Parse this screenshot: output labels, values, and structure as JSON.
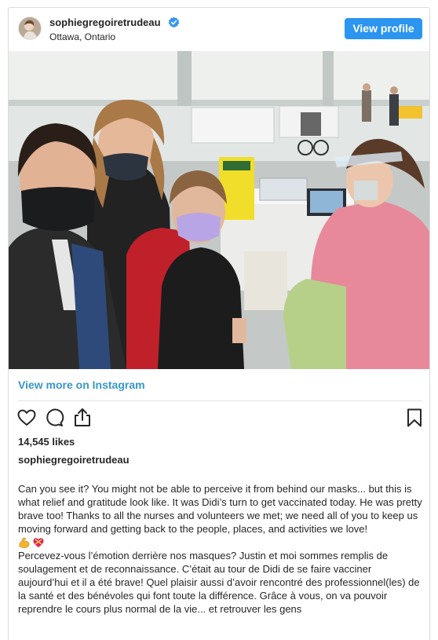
{
  "header": {
    "username": "sophiegregoiretrudeau",
    "location": "Ottawa, Ontario",
    "view_profile_label": "View profile"
  },
  "view_more_label": "View more on Instagram",
  "likes_text": "14,545 likes",
  "caption": {
    "username": "sophiegregoiretrudeau",
    "english": "Can you see it? You might not be able to perceive it from behind our masks... but this is what relief and gratitude look like. It was Didi’s turn to get vaccinated today. He was pretty brave too! Thanks to all the nurses and volunteers we met; we need all of you to keep us moving forward and getting back to the people, places, and activities we love!",
    "emojis": [
      "flexed-biceps",
      "heart-with-ribbon"
    ],
    "french": "Percevez-vous l’émotion derrière nos masques? Justin et moi sommes remplis de soulagement et de reconnaissance. C’était au tour de Didi de se faire vacciner aujourd’hui et il a été brave! Quel plaisir aussi d’avoir rencontré des professionnel(les) de la santé et des bénévoles qui font toute la différence. Grâce à vous, on va pouvoir reprendre le cours plus normal de la vie... et retrouver les gens"
  },
  "icons": {
    "verified": "verified-badge-icon",
    "like": "heart-icon",
    "comment": "comment-icon",
    "share": "share-icon",
    "save": "bookmark-icon"
  },
  "colors": {
    "accent": "#2b95f0",
    "link": "#3897c9",
    "text": "#262626",
    "border": "#dbdbdb"
  }
}
